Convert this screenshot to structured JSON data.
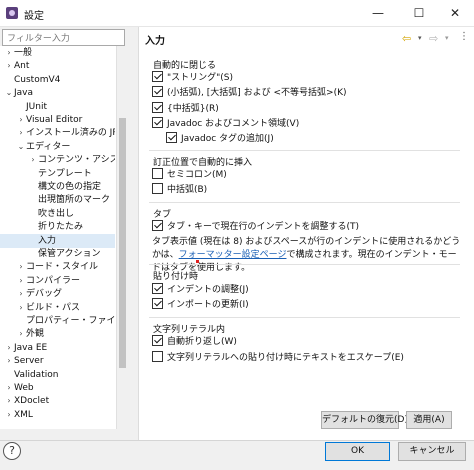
{
  "window": {
    "title": "設定",
    "minimize": "—",
    "maximize": "☐",
    "close": "✕"
  },
  "filter": {
    "placeholder": "フィルター入力"
  },
  "tree": [
    {
      "label": "一般",
      "arrow": "›",
      "level": 0
    },
    {
      "label": "Ant",
      "arrow": "›",
      "level": 0
    },
    {
      "label": "CustomV4",
      "arrow": "",
      "level": 0
    },
    {
      "label": "Java",
      "arrow": "⌄",
      "level": 0
    },
    {
      "label": "JUnit",
      "arrow": "",
      "level": 1
    },
    {
      "label": "Visual Editor",
      "arrow": "›",
      "level": 1
    },
    {
      "label": "インストール済みの JRE",
      "arrow": "›",
      "level": 1
    },
    {
      "label": "エディター",
      "arrow": "⌄",
      "level": 1
    },
    {
      "label": "コンテンツ・アシスト",
      "arrow": "›",
      "level": 2
    },
    {
      "label": "テンプレート",
      "arrow": "",
      "level": 2
    },
    {
      "label": "構文の色の指定",
      "arrow": "",
      "level": 2
    },
    {
      "label": "出現箇所のマーク",
      "arrow": "",
      "level": 2
    },
    {
      "label": "吹き出し",
      "arrow": "",
      "level": 2
    },
    {
      "label": "折りたたみ",
      "arrow": "",
      "level": 2
    },
    {
      "label": "入力",
      "arrow": "",
      "level": 2,
      "selected": true
    },
    {
      "label": "保管アクション",
      "arrow": "",
      "level": 2
    },
    {
      "label": "コード・スタイル",
      "arrow": "›",
      "level": 1
    },
    {
      "label": "コンパイラー",
      "arrow": "›",
      "level": 1
    },
    {
      "label": "デバッグ",
      "arrow": "›",
      "level": 1
    },
    {
      "label": "ビルド・パス",
      "arrow": "›",
      "level": 1
    },
    {
      "label": "プロパティー・ファイル・エ",
      "arrow": "",
      "level": 1
    },
    {
      "label": "外観",
      "arrow": "›",
      "level": 1
    },
    {
      "label": "Java EE",
      "arrow": "›",
      "level": 0
    },
    {
      "label": "Server",
      "arrow": "›",
      "level": 0
    },
    {
      "label": "Validation",
      "arrow": "",
      "level": 0
    },
    {
      "label": "Web",
      "arrow": "›",
      "level": 0
    },
    {
      "label": "XDoclet",
      "arrow": "›",
      "level": 0
    },
    {
      "label": "XML",
      "arrow": "›",
      "level": 0
    }
  ],
  "panel": {
    "title": "入力",
    "nav": {
      "back_icon": "back-arrow-icon",
      "forward_icon": "forward-arrow-icon",
      "menu_icon": "view-menu-icon"
    },
    "auto_close": {
      "label": "自動的に閉じる",
      "items": [
        {
          "label": "\"ストリング\"(S)",
          "checked": true
        },
        {
          "label": "(小括弧), [大括弧] および <不等号括弧>(K)",
          "checked": true
        },
        {
          "label": "{中括弧}(R)",
          "checked": true
        },
        {
          "label": "Javadoc およびコメント領域(V)",
          "checked": true
        },
        {
          "label": "Javadoc タグの追加(J)",
          "checked": true
        }
      ]
    },
    "insert": {
      "label": "訂正位置で自動的に挿入",
      "items": [
        {
          "label": "セミコロン(M)",
          "checked": false
        },
        {
          "label": "中括弧(B)",
          "checked": false
        }
      ]
    },
    "tab": {
      "label": "タブ",
      "items": [
        {
          "label": "タブ・キーで現在行のインデントを調整する(T)",
          "checked": true
        }
      ],
      "info_before": "タブ表示値 (現在は 8) およびスペースが行のインデントに使用されるかどうかは、",
      "info_link": "フォーマッター設定ページ",
      "info_after": "で構成されます。現在のインデント・モードはタブを使用します。"
    },
    "paste": {
      "label": "貼り付け時",
      "items": [
        {
          "label": "インデントの調整(J)",
          "checked": true
        },
        {
          "label": "インポートの更新(I)",
          "checked": true
        }
      ]
    },
    "string_literal": {
      "label": "文字列リテラル内",
      "items": [
        {
          "label": "自動折り返し(W)",
          "checked": true
        },
        {
          "label": "文字列リテラルへの貼り付け時にテキストをエスケープ(E)",
          "checked": false
        }
      ]
    },
    "buttons": {
      "restore_defaults": "デフォルトの復元(D)",
      "apply": "適用(A)"
    }
  },
  "footer": {
    "help": "?",
    "ok": "OK",
    "cancel": "キャンセル"
  }
}
